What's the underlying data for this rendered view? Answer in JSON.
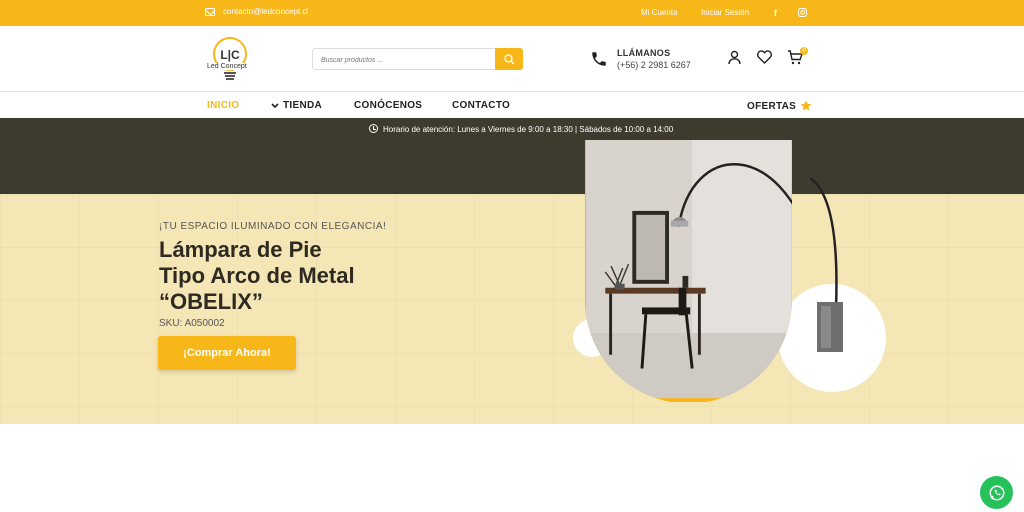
{
  "topbar": {
    "email": "contacto@ledconcept.cl",
    "account": "Mi Cuenta",
    "login": "Iniciar Sesión",
    "social": {
      "facebook": "f",
      "instagram": "instagram-icon"
    }
  },
  "header": {
    "logo_mark": "L|C",
    "logo_text": "Led Concept",
    "search_placeholder": "Buscar productos ...",
    "call_title": "LLÁMANOS",
    "call_phone": "(+56) 2 2981 6267",
    "cart_count": "0"
  },
  "nav": {
    "items": [
      {
        "label": "INICIO"
      },
      {
        "label": "TIENDA"
      },
      {
        "label": "CONÓCENOS"
      },
      {
        "label": "CONTACTO"
      }
    ],
    "offers": "OFERTAS"
  },
  "hours": "Horario de atención: Lunes a Viernes de 9:00 a 18:30 | Sábados de 10:00 a 14:00",
  "hero": {
    "tagline": "¡TU ESPACIO ILUMINADO CON ELEGANCIA!",
    "title_lines": [
      "Lámpara de Pie",
      "Tipo Arco de Metal",
      "“OBELIX”"
    ],
    "sku": "SKU: A050002",
    "cta": "¡Comprar Ahora!"
  },
  "colors": {
    "accent": "#f8b718",
    "dark": "#3d3a2e",
    "hero_bg": "#f5e6b5",
    "whatsapp": "#25c15b"
  }
}
